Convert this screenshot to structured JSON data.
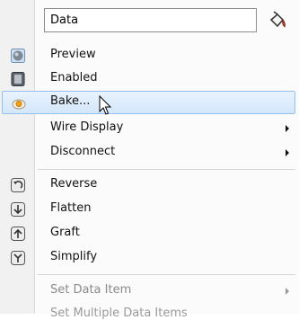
{
  "name_field": {
    "value": "Data"
  },
  "items": {
    "preview": {
      "label": "Preview"
    },
    "enabled": {
      "label": "Enabled"
    },
    "bake": {
      "label": "Bake..."
    },
    "wire_display": {
      "label": "Wire Display"
    },
    "disconnect": {
      "label": "Disconnect"
    },
    "reverse": {
      "label": "Reverse"
    },
    "flatten": {
      "label": "Flatten"
    },
    "graft": {
      "label": "Graft"
    },
    "simplify": {
      "label": "Simplify"
    },
    "set_data_item": {
      "label": "Set Data Item"
    },
    "set_multiple_partial": {
      "label": "Set Multiple Data Items"
    }
  },
  "icons": {
    "preview": "preview-sphere-icon",
    "enabled": "enabled-switch-icon",
    "bake": "bake-egg-icon",
    "reverse": "reverse-icon",
    "flatten": "flatten-icon",
    "graft": "graft-icon",
    "simplify": "simplify-icon",
    "name_box": "paint-bucket-icon"
  },
  "colors": {
    "highlight_fill": "#d9eafc",
    "highlight_border": "#96c0ec",
    "gutter": "#f1f1f1",
    "disabled_text": "#8a8a8a"
  }
}
